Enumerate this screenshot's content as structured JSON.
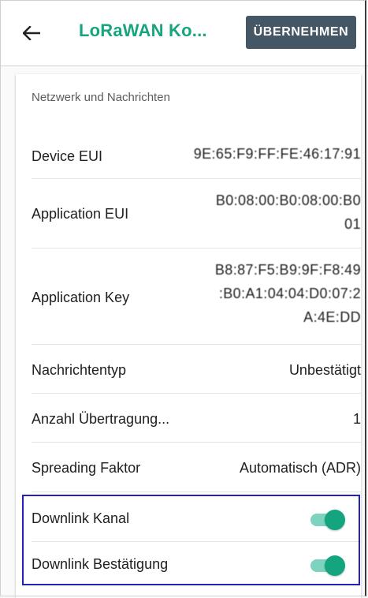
{
  "header": {
    "title": "LoRaWAN Ko...",
    "apply_label": "ÜBERNEHMEN"
  },
  "section_title": "Netzwerk und Nachrichten",
  "rows": {
    "device_eui": {
      "label": "Device EUI",
      "value": "9E:65:F9:FF:FE:46:17:91"
    },
    "app_eui": {
      "label": "Application EUI",
      "value_line1": "B0:08:00:B0:08:00:B0",
      "value_line2": "01"
    },
    "app_key": {
      "label": "Application Key",
      "value_line1": "B8:87:F5:B9:9F:F8:49",
      "value_line2": ":B0:A1:04:04:D0:07:2",
      "value_line3": "A:4E:DD"
    },
    "msg_type": {
      "label": "Nachrichtentyp",
      "value": "Unbestätigt"
    },
    "transmissions": {
      "label": "Anzahl Übertragung...",
      "value": "1"
    },
    "spreading": {
      "label": "Spreading Faktor",
      "value": "Automatisch (ADR)"
    },
    "downlink_channel": {
      "label": "Downlink Kanal",
      "enabled": true
    },
    "downlink_ack": {
      "label": "Downlink Bestätigung",
      "enabled": true
    }
  },
  "colors": {
    "accent": "#17a580",
    "switch_thumb": "#14a57e",
    "switch_track": "#7ed3bf",
    "button_bg": "#455765",
    "highlight_border": "#2321b8"
  },
  "icons": {
    "back": "arrow-left-icon"
  }
}
